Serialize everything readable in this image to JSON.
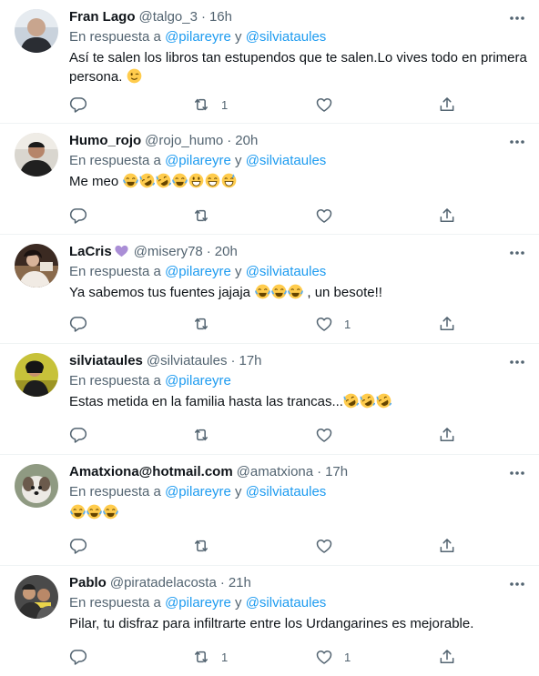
{
  "replying_prefix": "En respuesta a",
  "conjunction": "y",
  "tweets": [
    {
      "name": "Fran Lago",
      "handle": "@talgo_3",
      "time": "16h",
      "mentions": [
        "@pilareyre",
        "@silviataules"
      ],
      "text_parts": [
        "Así te salen los libros tan estupendos que te salen.Lo vives todo en primera persona. "
      ],
      "emojis": [
        "winking-face"
      ],
      "counts": {
        "reply": "",
        "retweet": "1",
        "like": ""
      }
    },
    {
      "name": "Humo_rojo",
      "handle": "@rojo_humo",
      "time": "20h",
      "mentions": [
        "@pilareyre",
        "@silviataules"
      ],
      "text_parts": [
        "Me meo "
      ],
      "emojis": [
        "tears-of-joy",
        "rolling-laughing",
        "rolling-laughing",
        "tears-of-joy",
        "grinning",
        "grinning-smile",
        "sweat-smile"
      ],
      "counts": {
        "reply": "",
        "retweet": "",
        "like": ""
      }
    },
    {
      "name": "LaCris",
      "name_emoji": "purple-heart",
      "handle": "@misery78",
      "time": "20h",
      "mentions": [
        "@pilareyre",
        "@silviataules"
      ],
      "text_parts": [
        "Ya sabemos tus fuentes jajaja ",
        " , un besote!!"
      ],
      "emojis": [
        "tears-of-joy",
        "tears-of-joy",
        "tears-of-joy"
      ],
      "counts": {
        "reply": "",
        "retweet": "",
        "like": "1"
      }
    },
    {
      "name": "silviataules",
      "handle": "@silviataules",
      "time": "17h",
      "mentions": [
        "@pilareyre"
      ],
      "text_parts": [
        "Estas metida en la familia hasta las trancas..."
      ],
      "emojis": [
        "rolling-laughing",
        "rolling-laughing",
        "rolling-laughing"
      ],
      "counts": {
        "reply": "",
        "retweet": "",
        "like": ""
      }
    },
    {
      "name": "Amatxiona@hotmail.com",
      "handle": "@amatxiona",
      "time": "17h",
      "mentions": [
        "@pilareyre",
        "@silviataules"
      ],
      "text_parts": [
        ""
      ],
      "emojis": [
        "tears-of-joy",
        "tears-of-joy",
        "tears-of-joy"
      ],
      "counts": {
        "reply": "",
        "retweet": "",
        "like": ""
      }
    },
    {
      "name": "Pablo",
      "handle": "@piratadelacosta",
      "time": "21h",
      "mentions": [
        "@pilareyre",
        "@silviataules"
      ],
      "text_parts": [
        "Pilar, tu disfraz para infiltrarte entre los Urdangarines es mejorable."
      ],
      "emojis": [],
      "counts": {
        "reply": "",
        "retweet": "1",
        "like": "1"
      }
    }
  ],
  "colors": {
    "text": "#0f1419",
    "secondary": "#536471",
    "link": "#1d9bf0",
    "divider": "#eff3f4"
  }
}
